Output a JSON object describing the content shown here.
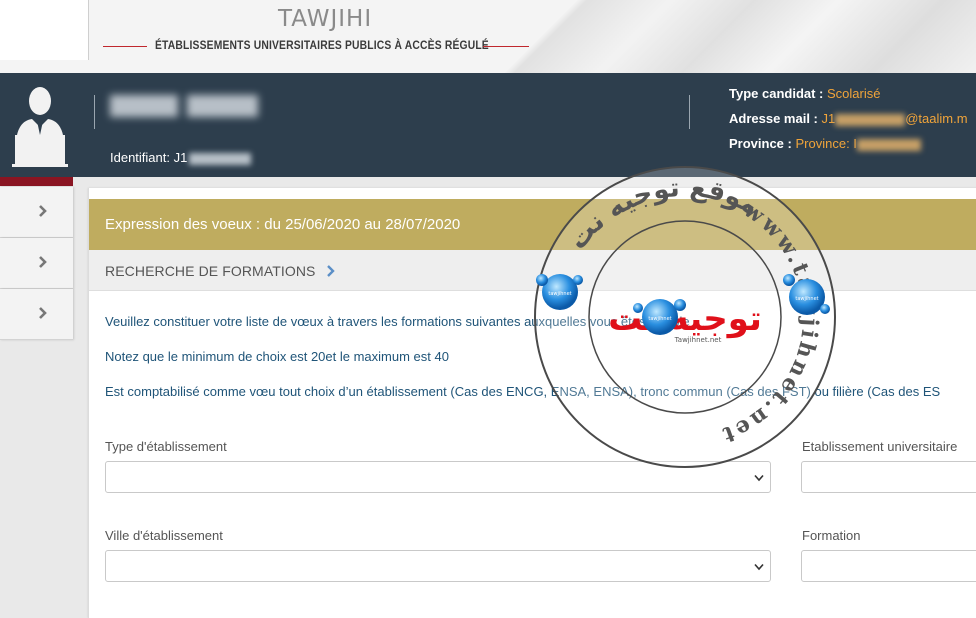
{
  "header": {
    "brand_title": "TAWJIHI",
    "brand_subtitle": "ÉTABLISSEMENTS UNIVERSITAIRES PUBLICS À ACCÈS RÉGULÉ"
  },
  "user": {
    "identifiant_label": "Identifiant: J1",
    "type_candidat_label": "Type candidat :",
    "type_candidat_value": "Scolarisé",
    "email_label": "Adresse mail :",
    "email_prefix": "J1",
    "email_suffix": "@taalim.m",
    "province_label": "Province :",
    "province_value": "Province: I"
  },
  "main": {
    "period_banner": "Expression des voeux : du 25/06/2020 au 28/07/2020",
    "section_title": "RECHERCHE DE FORMATIONS",
    "paragraphs": {
      "p1": "Veuillez constituer votre liste de vœux à travers les formations suivantes auxquelles vous êtes éligible",
      "p2_prefix": "Notez que le minimum de choix est",
      "p2_min": "20",
      "p2_middle": "et le maximum est",
      "p2_max": "40",
      "p3": "Est comptabilisé comme vœu tout choix d’un établissement (Cas des ENCG, ENSA, ENSA), tronc commun (Cas des FST) ou filière (Cas des ES"
    },
    "fields": {
      "type_etablissement_label": "Type d'établissement",
      "etablissement_universitaire_label": "Etablissement universitaire",
      "ville_etablissement_label": "Ville d'établissement",
      "formation_label": "Formation"
    }
  },
  "watermark": {
    "ring_text": "www.tawjihnet.net",
    "arabic_center": "توجيه نت",
    "arabic_top": "موقع توجيه نت",
    "small_site": "Tawjihnet.net",
    "bubble_text": "tawjihnet"
  },
  "colors": {
    "band": "#2d3e4d",
    "banner": "#bfac5f",
    "accent_orange": "#f0a43a",
    "brand_red": "#c0272d",
    "link_blue": "#1f5478"
  }
}
